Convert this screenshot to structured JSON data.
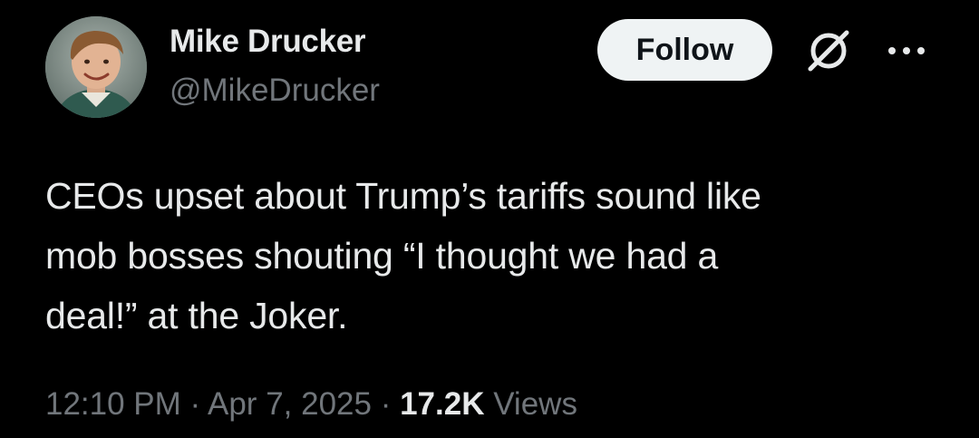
{
  "author": {
    "name": "Mike Drucker",
    "handle": "@MikeDrucker",
    "avatar_icon": "avatar-photo"
  },
  "actions": {
    "follow_label": "Follow",
    "grok_icon": "grok-icon",
    "more_icon": "more-options-icon"
  },
  "tweet": {
    "text": "CEOs upset about Trump’s tariffs sound like\nmob bosses shouting “I thought we had a\ndeal!” at the Joker."
  },
  "meta": {
    "time": "12:10 PM",
    "separator": " · ",
    "date": "Apr 7, 2025",
    "views_count": "17.2K",
    "views_label": " Views"
  },
  "colors": {
    "background": "#000000",
    "primary_text": "#e7e9ea",
    "secondary_text": "#71767b",
    "follow_bg": "#eff3f4",
    "follow_text": "#0f1419"
  }
}
